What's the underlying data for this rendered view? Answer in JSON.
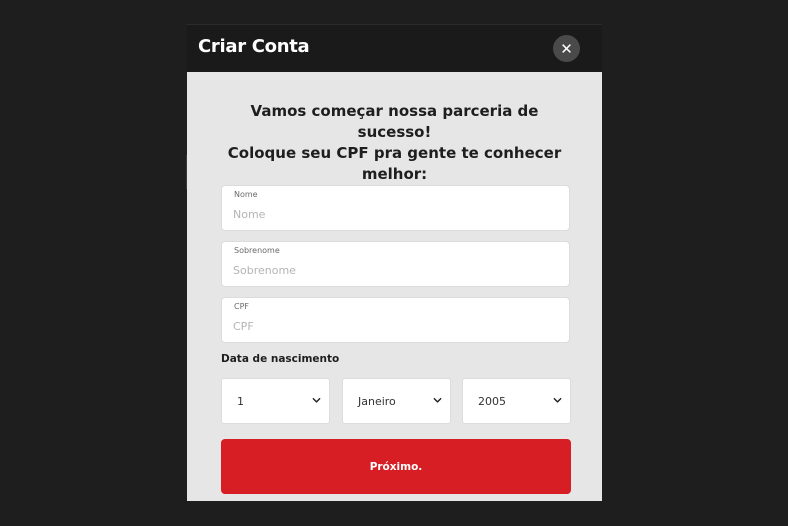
{
  "modal": {
    "title": "Criar Conta",
    "close_icon": "close-icon"
  },
  "form": {
    "headline_line1": "Vamos começar nossa parceria de sucesso!",
    "headline_line2": "Coloque seu CPF pra gente te conhecer",
    "headline_line3": "melhor:",
    "first_name": {
      "label": "Nome",
      "placeholder": "Nome",
      "value": ""
    },
    "last_name": {
      "label": "Sobrenome",
      "placeholder": "Sobrenome",
      "value": ""
    },
    "cpf": {
      "label": "CPF",
      "placeholder": "CPF",
      "value": ""
    },
    "birth_date": {
      "label": "Data de nascimento",
      "day": "1",
      "month": "Janeiro",
      "year": "2005",
      "dropdown_icon": "chevron-down-icon"
    },
    "next_label": "Próximo."
  },
  "colors": {
    "page_background": "#1e1e1e",
    "header_background": "#1a1a1a",
    "body_background": "#e6e6e6",
    "accent_red": "#d81e25",
    "close_button": "#4a4a4a"
  }
}
